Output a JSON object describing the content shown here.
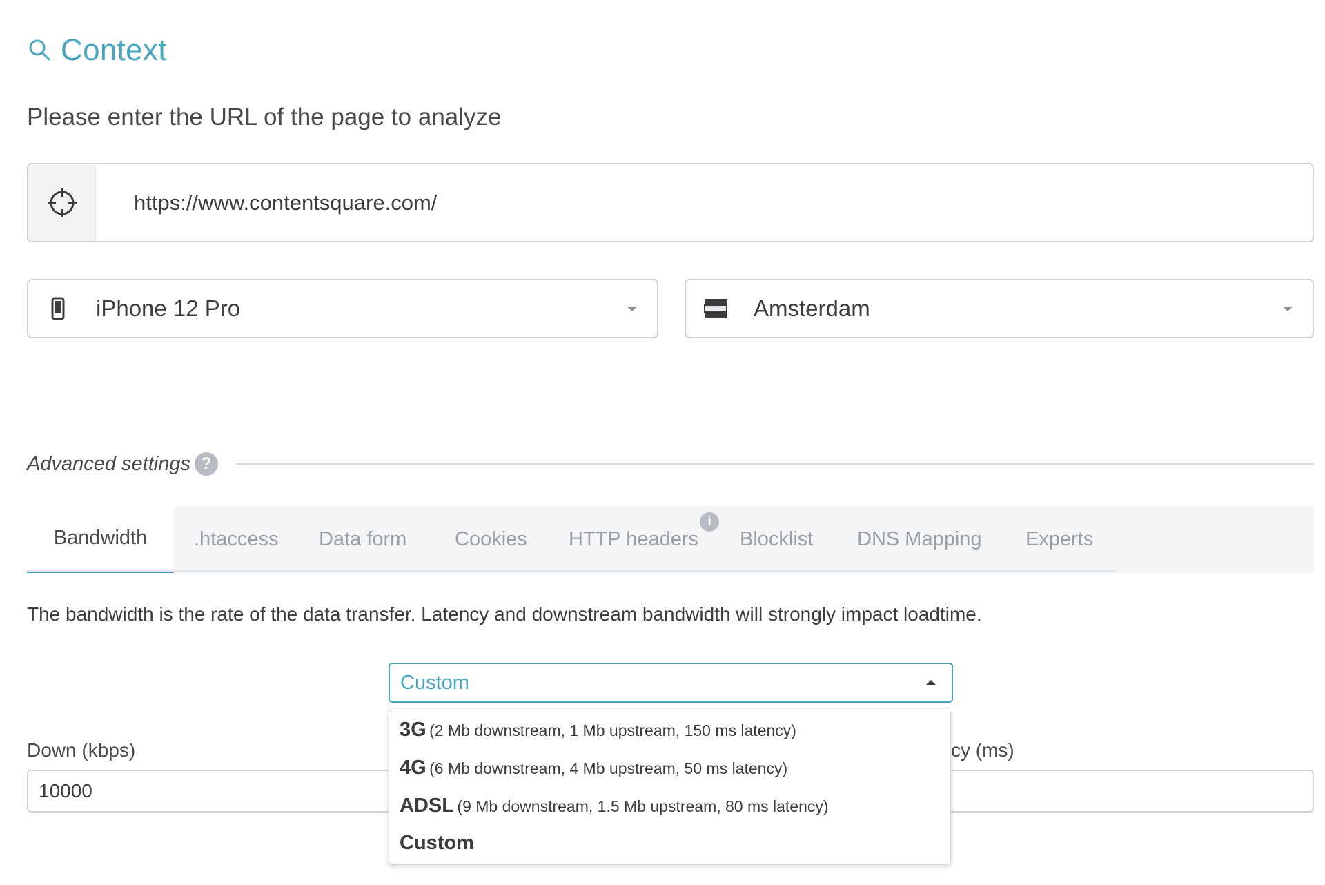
{
  "header": {
    "title": "Context",
    "icon": "search-icon"
  },
  "prompt": "Please enter the URL of the page to analyze",
  "url": {
    "value": "https://www.contentsquare.com/",
    "icon": "crosshair-icon"
  },
  "device": {
    "value": "iPhone 12 Pro",
    "icon": "phone-icon"
  },
  "location": {
    "value": "Amsterdam",
    "icon": "server-icon"
  },
  "advanced": {
    "label": "Advanced settings",
    "help": "?"
  },
  "tabs": [
    {
      "label": "Bandwidth",
      "active": true
    },
    {
      "label": ".htaccess"
    },
    {
      "label": "Data form"
    },
    {
      "label": "Cookies"
    },
    {
      "label": "HTTP headers",
      "badge": "i"
    },
    {
      "label": "Blocklist"
    },
    {
      "label": "DNS Mapping"
    },
    {
      "label": "Experts"
    }
  ],
  "bandwidth": {
    "description": "The bandwidth is the rate of the data transfer. Latency and downstream bandwidth will strongly impact loadtime.",
    "selected": "Custom",
    "options": [
      {
        "name": "3G",
        "detail": "(2 Mb downstream, 1 Mb upstream, 150 ms latency)"
      },
      {
        "name": "4G",
        "detail": "(6 Mb downstream, 4 Mb upstream, 50 ms latency)"
      },
      {
        "name": "ADSL",
        "detail": "(9 Mb downstream, 1.5 Mb upstream, 80 ms latency)"
      },
      {
        "name": "Custom",
        "detail": ""
      }
    ],
    "down_label": "Down (kbps)",
    "down_value": "10000",
    "latency_label_visible": "cy (ms)"
  },
  "colors": {
    "accent": "#4aa6bf",
    "border": "#cfd3d8"
  }
}
